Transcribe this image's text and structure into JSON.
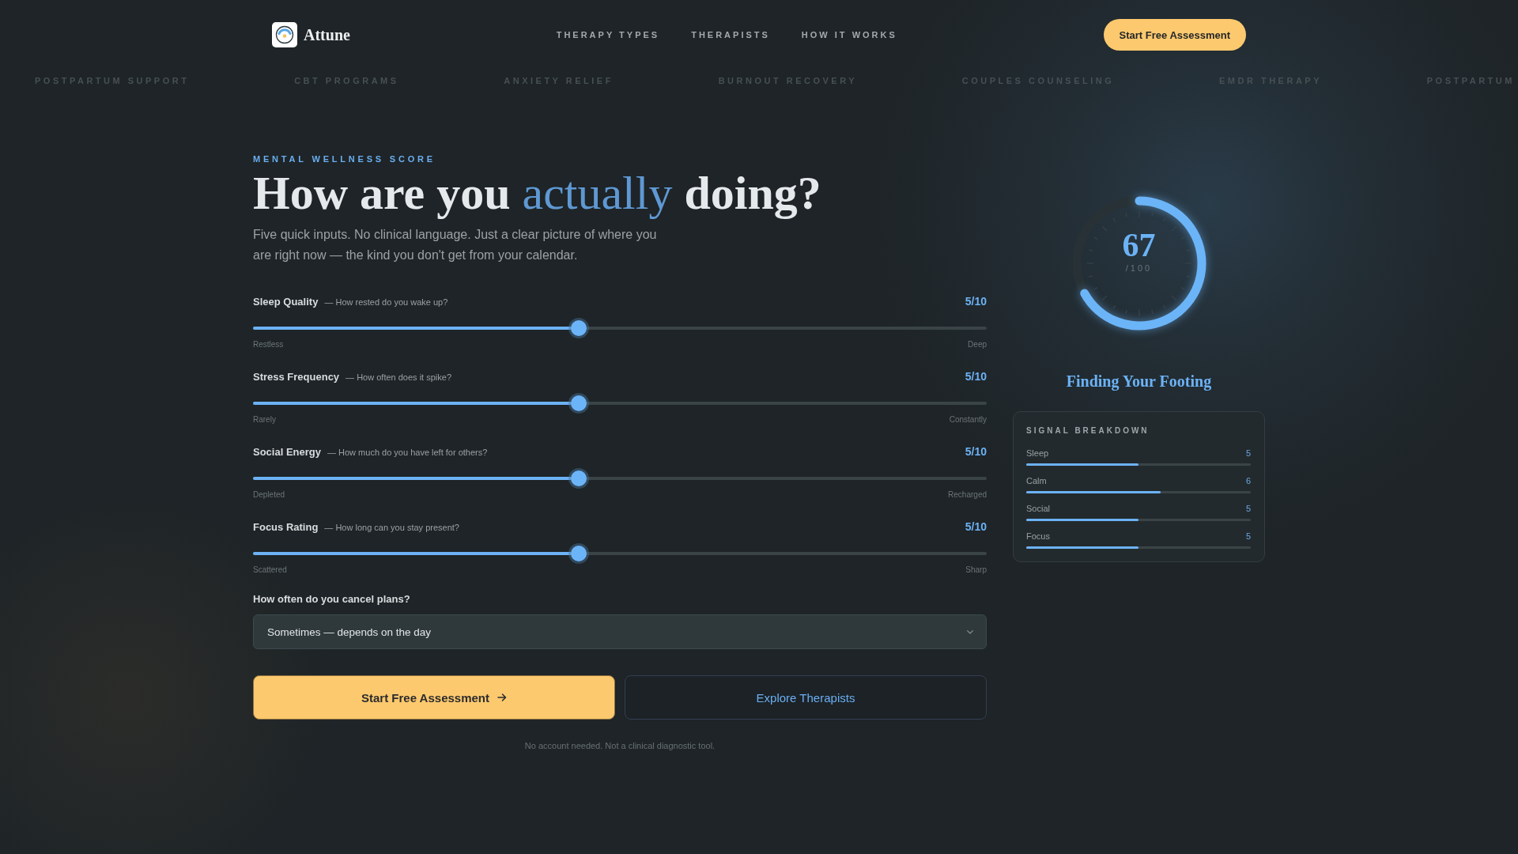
{
  "header": {
    "brand": "Attune",
    "nav": [
      "THERAPY TYPES",
      "THERAPISTS",
      "HOW IT WORKS"
    ],
    "cta": "Start Free Assessment"
  },
  "ticker": [
    "POSTPARTUM SUPPORT",
    "CBT PROGRAMS",
    "ANXIETY RELIEF",
    "BURNOUT RECOVERY",
    "COUPLES COUNSELING",
    "EMDR THERAPY",
    "POSTPARTUM"
  ],
  "assessment": {
    "eyebrow": "MENTAL WELLNESS SCORE",
    "heading": {
      "before": "How are you",
      "accent": "actually",
      "after": "doing?"
    },
    "intro": "Five quick inputs. No clinical language. Just a clear picture of where you are right now — the kind you don't get from your calendar.",
    "sliders": [
      {
        "label": "Sleep Quality",
        "hint": "— How rested do you wake up?",
        "value": "5/10",
        "level": 0.444,
        "low": "Restless",
        "high": "Deep"
      },
      {
        "label": "Stress Frequency",
        "hint": "— How often does it spike?",
        "value": "5/10",
        "level": 0.444,
        "low": "Rarely",
        "high": "Constantly"
      },
      {
        "label": "Social Energy",
        "hint": "— How much do you have left for others?",
        "value": "5/10",
        "level": 0.444,
        "low": "Depleted",
        "high": "Recharged"
      },
      {
        "label": "Focus Rating",
        "hint": "— How long can you stay present?",
        "value": "5/10",
        "level": 0.444,
        "low": "Scattered",
        "high": "Sharp"
      }
    ],
    "question": {
      "label": "How often do you cancel plans?",
      "value": "Sometimes — depends on the day"
    },
    "primary_button": "Start Free Assessment",
    "secondary_button": "Explore Therapists",
    "note": "No account needed. Not a clinical diagnostic tool."
  },
  "result": {
    "score": "67",
    "scale": "/100",
    "chart_data": {
      "type": "donut",
      "values": [
        67,
        33
      ],
      "colors": [
        "#6cb4f8",
        "#283236"
      ]
    },
    "status": "Finding Your Footing",
    "breakdown": {
      "title": "SIGNAL BREAKDOWN",
      "items": [
        {
          "label": "Sleep",
          "value": "5",
          "level": 0.5
        },
        {
          "label": "Calm",
          "value": "6",
          "level": 0.6
        },
        {
          "label": "Social",
          "value": "5",
          "level": 0.5
        },
        {
          "label": "Focus",
          "value": "5",
          "level": 0.5
        }
      ]
    }
  }
}
